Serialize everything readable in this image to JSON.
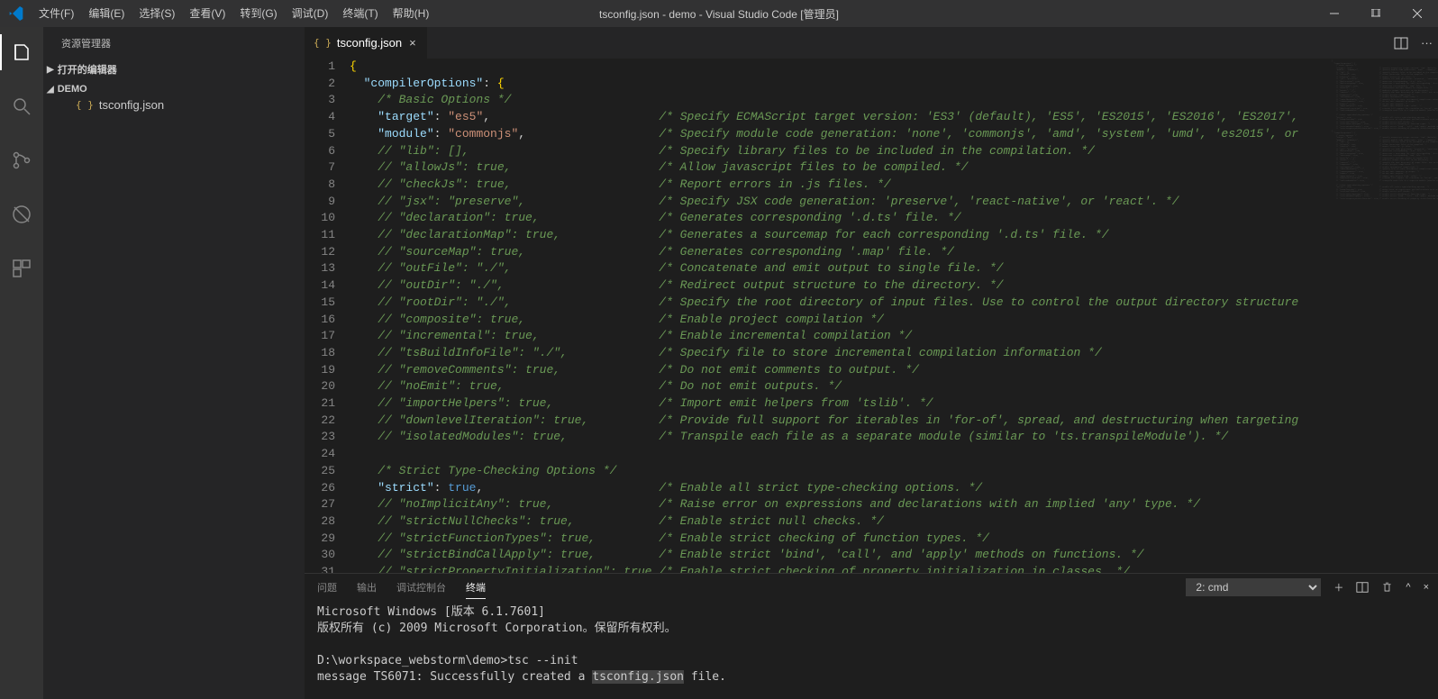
{
  "title": "tsconfig.json - demo - Visual Studio Code [管理员]",
  "menubar": [
    "文件(F)",
    "编辑(E)",
    "选择(S)",
    "查看(V)",
    "转到(G)",
    "调试(D)",
    "终端(T)",
    "帮助(H)"
  ],
  "sidebar": {
    "title": "资源管理器",
    "sections": [
      {
        "chev": "▶",
        "label": "打开的编辑器"
      },
      {
        "chev": "◢",
        "label": "DEMO"
      }
    ],
    "files": [
      {
        "icon": "{ }",
        "name": "tsconfig.json"
      }
    ]
  },
  "tab": {
    "icon": "{ }",
    "name": "tsconfig.json",
    "dirty": false
  },
  "code_lines": [
    {
      "n": 1,
      "raw": "{",
      "tokens": [
        {
          "t": "brace",
          "v": "{"
        }
      ]
    },
    {
      "n": 2,
      "raw": "  \"compilerOptions\": {",
      "tokens": [
        {
          "t": "txt",
          "v": "  "
        },
        {
          "t": "key",
          "v": "\"compilerOptions\""
        },
        {
          "t": "punct",
          "v": ": "
        },
        {
          "t": "brace",
          "v": "{"
        }
      ]
    },
    {
      "n": 3,
      "raw": "    /* Basic Options */",
      "tokens": [
        {
          "t": "txt",
          "v": "    "
        },
        {
          "t": "comment",
          "v": "/* Basic Options */"
        }
      ]
    },
    {
      "n": 4,
      "raw": "    \"target\": \"es5\",",
      "tokens": [
        {
          "t": "txt",
          "v": "    "
        },
        {
          "t": "key",
          "v": "\"target\""
        },
        {
          "t": "punct",
          "v": ": "
        },
        {
          "t": "str",
          "v": "\"es5\""
        },
        {
          "t": "punct",
          "v": ","
        }
      ],
      "comment": "/* Specify ECMAScript target version: 'ES3' (default), 'ES5', 'ES2015', 'ES2016', 'ES2017',"
    },
    {
      "n": 5,
      "raw": "    \"module\": \"commonjs\",",
      "tokens": [
        {
          "t": "txt",
          "v": "    "
        },
        {
          "t": "key",
          "v": "\"module\""
        },
        {
          "t": "punct",
          "v": ": "
        },
        {
          "t": "str",
          "v": "\"commonjs\""
        },
        {
          "t": "punct",
          "v": ","
        }
      ],
      "comment": "/* Specify module code generation: 'none', 'commonjs', 'amd', 'system', 'umd', 'es2015', or"
    },
    {
      "n": 6,
      "raw": "    // \"lib\": [],",
      "tokens": [
        {
          "t": "txt",
          "v": "    "
        },
        {
          "t": "comment",
          "v": "// \"lib\": [],"
        }
      ],
      "comment": "/* Specify library files to be included in the compilation. */"
    },
    {
      "n": 7,
      "raw": "    // \"allowJs\": true,",
      "tokens": [
        {
          "t": "txt",
          "v": "    "
        },
        {
          "t": "comment",
          "v": "// \"allowJs\": true,"
        }
      ],
      "comment": "/* Allow javascript files to be compiled. */"
    },
    {
      "n": 8,
      "raw": "    // \"checkJs\": true,",
      "tokens": [
        {
          "t": "txt",
          "v": "    "
        },
        {
          "t": "comment",
          "v": "// \"checkJs\": true,"
        }
      ],
      "comment": "/* Report errors in .js files. */"
    },
    {
      "n": 9,
      "raw": "    // \"jsx\": \"preserve\",",
      "tokens": [
        {
          "t": "txt",
          "v": "    "
        },
        {
          "t": "comment",
          "v": "// \"jsx\": \"preserve\","
        }
      ],
      "comment": "/* Specify JSX code generation: 'preserve', 'react-native', or 'react'. */"
    },
    {
      "n": 10,
      "raw": "    // \"declaration\": true,",
      "tokens": [
        {
          "t": "txt",
          "v": "    "
        },
        {
          "t": "comment",
          "v": "// \"declaration\": true,"
        }
      ],
      "comment": "/* Generates corresponding '.d.ts' file. */"
    },
    {
      "n": 11,
      "raw": "    // \"declarationMap\": true,",
      "tokens": [
        {
          "t": "txt",
          "v": "    "
        },
        {
          "t": "comment",
          "v": "// \"declarationMap\": true,"
        }
      ],
      "comment": "/* Generates a sourcemap for each corresponding '.d.ts' file. */"
    },
    {
      "n": 12,
      "raw": "    // \"sourceMap\": true,",
      "tokens": [
        {
          "t": "txt",
          "v": "    "
        },
        {
          "t": "comment",
          "v": "// \"sourceMap\": true,"
        }
      ],
      "comment": "/* Generates corresponding '.map' file. */"
    },
    {
      "n": 13,
      "raw": "    // \"outFile\": \"./\",",
      "tokens": [
        {
          "t": "txt",
          "v": "    "
        },
        {
          "t": "comment",
          "v": "// \"outFile\": \"./\","
        }
      ],
      "comment": "/* Concatenate and emit output to single file. */"
    },
    {
      "n": 14,
      "raw": "    // \"outDir\": \"./\",",
      "tokens": [
        {
          "t": "txt",
          "v": "    "
        },
        {
          "t": "comment",
          "v": "// \"outDir\": \"./\","
        }
      ],
      "comment": "/* Redirect output structure to the directory. */"
    },
    {
      "n": 15,
      "raw": "    // \"rootDir\": \"./\",",
      "tokens": [
        {
          "t": "txt",
          "v": "    "
        },
        {
          "t": "comment",
          "v": "// \"rootDir\": \"./\","
        }
      ],
      "comment": "/* Specify the root directory of input files. Use to control the output directory structure"
    },
    {
      "n": 16,
      "raw": "    // \"composite\": true,",
      "tokens": [
        {
          "t": "txt",
          "v": "    "
        },
        {
          "t": "comment",
          "v": "// \"composite\": true,"
        }
      ],
      "comment": "/* Enable project compilation */"
    },
    {
      "n": 17,
      "raw": "    // \"incremental\": true,",
      "tokens": [
        {
          "t": "txt",
          "v": "    "
        },
        {
          "t": "comment",
          "v": "// \"incremental\": true,"
        }
      ],
      "comment": "/* Enable incremental compilation */"
    },
    {
      "n": 18,
      "raw": "    // \"tsBuildInfoFile\": \"./\",",
      "tokens": [
        {
          "t": "txt",
          "v": "    "
        },
        {
          "t": "comment",
          "v": "// \"tsBuildInfoFile\": \"./\","
        }
      ],
      "comment": "/* Specify file to store incremental compilation information */"
    },
    {
      "n": 19,
      "raw": "    // \"removeComments\": true,",
      "tokens": [
        {
          "t": "txt",
          "v": "    "
        },
        {
          "t": "comment",
          "v": "// \"removeComments\": true,"
        }
      ],
      "comment": "/* Do not emit comments to output. */"
    },
    {
      "n": 20,
      "raw": "    // \"noEmit\": true,",
      "tokens": [
        {
          "t": "txt",
          "v": "    "
        },
        {
          "t": "comment",
          "v": "// \"noEmit\": true,"
        }
      ],
      "comment": "/* Do not emit outputs. */"
    },
    {
      "n": 21,
      "raw": "    // \"importHelpers\": true,",
      "tokens": [
        {
          "t": "txt",
          "v": "    "
        },
        {
          "t": "comment",
          "v": "// \"importHelpers\": true,"
        }
      ],
      "comment": "/* Import emit helpers from 'tslib'. */"
    },
    {
      "n": 22,
      "raw": "    // \"downlevelIteration\": true,",
      "tokens": [
        {
          "t": "txt",
          "v": "    "
        },
        {
          "t": "comment",
          "v": "// \"downlevelIteration\": true,"
        }
      ],
      "comment": "/* Provide full support for iterables in 'for-of', spread, and destructuring when targeting"
    },
    {
      "n": 23,
      "raw": "    // \"isolatedModules\": true,",
      "tokens": [
        {
          "t": "txt",
          "v": "    "
        },
        {
          "t": "comment",
          "v": "// \"isolatedModules\": true,"
        }
      ],
      "comment": "/* Transpile each file as a separate module (similar to 'ts.transpileModule'). */"
    },
    {
      "n": 24,
      "raw": "",
      "tokens": []
    },
    {
      "n": 25,
      "raw": "    /* Strict Type-Checking Options */",
      "tokens": [
        {
          "t": "txt",
          "v": "    "
        },
        {
          "t": "comment",
          "v": "/* Strict Type-Checking Options */"
        }
      ]
    },
    {
      "n": 26,
      "raw": "    \"strict\": true,",
      "tokens": [
        {
          "t": "txt",
          "v": "    "
        },
        {
          "t": "key",
          "v": "\"strict\""
        },
        {
          "t": "punct",
          "v": ": "
        },
        {
          "t": "bool",
          "v": "true"
        },
        {
          "t": "punct",
          "v": ","
        }
      ],
      "comment": "/* Enable all strict type-checking options. */"
    },
    {
      "n": 27,
      "raw": "    // \"noImplicitAny\": true,",
      "tokens": [
        {
          "t": "txt",
          "v": "    "
        },
        {
          "t": "comment",
          "v": "// \"noImplicitAny\": true,"
        }
      ],
      "comment": "/* Raise error on expressions and declarations with an implied 'any' type. */"
    },
    {
      "n": 28,
      "raw": "    // \"strictNullChecks\": true,",
      "tokens": [
        {
          "t": "txt",
          "v": "    "
        },
        {
          "t": "comment",
          "v": "// \"strictNullChecks\": true,"
        }
      ],
      "comment": "/* Enable strict null checks. */"
    },
    {
      "n": 29,
      "raw": "    // \"strictFunctionTypes\": true,",
      "tokens": [
        {
          "t": "txt",
          "v": "    "
        },
        {
          "t": "comment",
          "v": "// \"strictFunctionTypes\": true,"
        }
      ],
      "comment": "/* Enable strict checking of function types. */"
    },
    {
      "n": 30,
      "raw": "    // \"strictBindCallApply\": true,",
      "tokens": [
        {
          "t": "txt",
          "v": "    "
        },
        {
          "t": "comment",
          "v": "// \"strictBindCallApply\": true,"
        }
      ],
      "comment": "/* Enable strict 'bind', 'call', and 'apply' methods on functions. */"
    },
    {
      "n": 31,
      "raw": "    // \"strictPropertyInitialization\": true,",
      "tokens": [
        {
          "t": "txt",
          "v": "    "
        },
        {
          "t": "comment",
          "v": "// \"strictPropertyInitialization\": true,"
        }
      ],
      "comment": "/* Enable strict checking of property initialization in classes. */"
    }
  ],
  "comment_col": 44,
  "panel": {
    "tabs": [
      "问题",
      "输出",
      "调试控制台",
      "终端"
    ],
    "active": 3,
    "terminal_select": "2: cmd",
    "lines": [
      "Microsoft Windows [版本 6.1.7601]",
      "版权所有 (c) 2009 Microsoft Corporation。保留所有权利。",
      "",
      "D:\\workspace_webstorm\\demo>tsc --init",
      "message TS6071: Successfully created a tsconfig.json file."
    ],
    "highlight": "tsconfig.json"
  }
}
